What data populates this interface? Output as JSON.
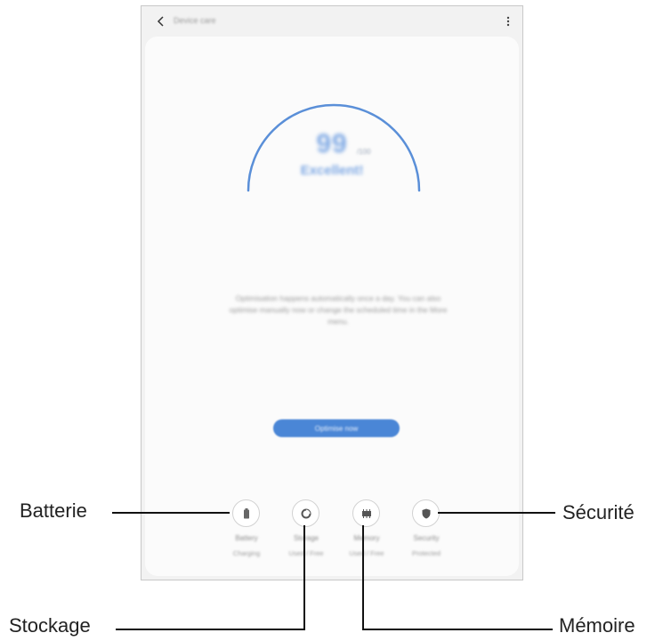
{
  "topbar": {
    "title": "Device care"
  },
  "gauge": {
    "score": "99",
    "total": "/100",
    "status": "Excellent!",
    "level": 0.99,
    "accent": "#5a8fd8"
  },
  "description": "Optimisation happens automatically once a day. You can also optimise manually now or change the scheduled time in the More menu.",
  "optimize_button": "Optimise now",
  "metrics": [
    {
      "icon": "battery-icon",
      "name": "Battery",
      "value": "Charging"
    },
    {
      "icon": "storage-icon",
      "name": "Storage",
      "value": "Used / Free"
    },
    {
      "icon": "memory-icon",
      "name": "Memory",
      "value": "Used / Free"
    },
    {
      "icon": "security-icon",
      "name": "Security",
      "value": "Protected"
    }
  ],
  "callouts": {
    "battery": "Batterie",
    "storage": "Stockage",
    "memory": "Mémoire",
    "security": "Sécurité"
  }
}
